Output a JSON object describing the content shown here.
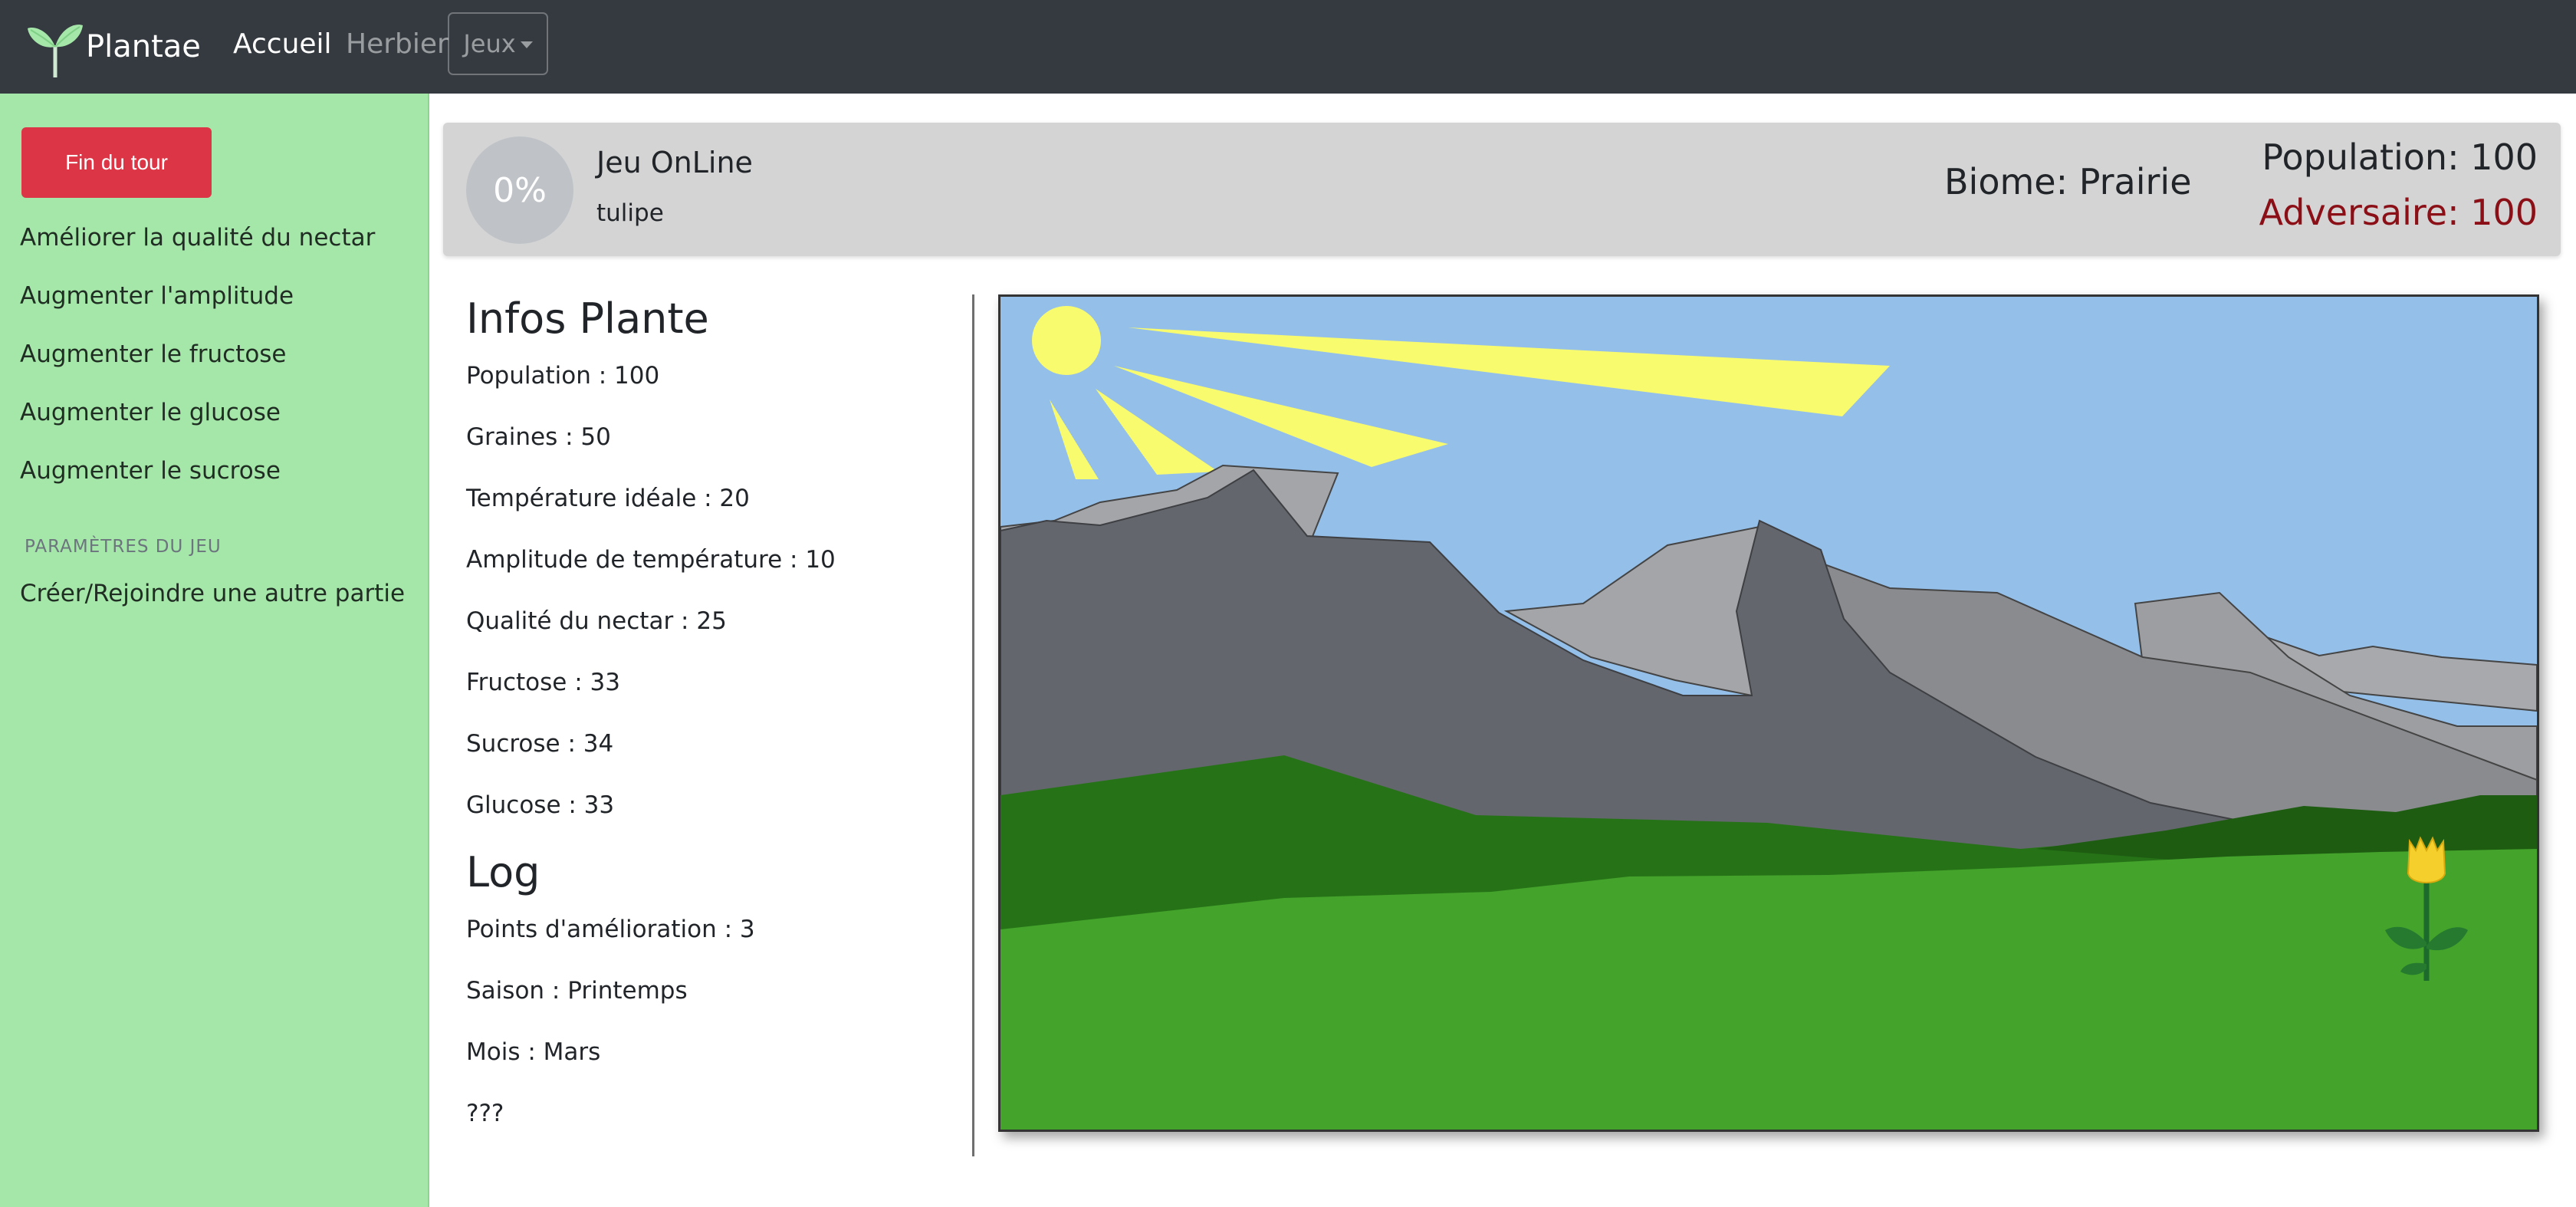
{
  "navbar": {
    "brand": "Plantae",
    "links": [
      {
        "label": "Accueil",
        "active": true
      },
      {
        "label": "Herbier",
        "active": false
      }
    ],
    "dropdown_label": "Jeux"
  },
  "sidebar": {
    "end_turn_label": "Fin du tour",
    "actions": [
      "Améliorer la qualité du nectar",
      "Augmenter l'amplitude",
      "Augmenter le fructose",
      "Augmenter le glucose",
      "Augmenter le sucrose"
    ],
    "settings_heading": "PARAMÈTRES DU JEU",
    "settings_items": [
      "Créer/Rejoindre une autre partie"
    ]
  },
  "header": {
    "progress": "0%",
    "game_title": "Jeu OnLine",
    "plant_name": "tulipe",
    "biome": "Biome: Prairie",
    "population": "Population: 100",
    "adversary": "Adversaire: 100"
  },
  "infos": {
    "title": "Infos Plante",
    "lines": [
      "Population : 100",
      "Graines : 50",
      "Température idéale : 20",
      "Amplitude de température : 10",
      "Qualité du nectar : 25",
      "Fructose : 33",
      "Sucrose : 34",
      "Glucose : 33"
    ]
  },
  "log": {
    "title": "Log",
    "lines": [
      "Points d'amélioration : 3",
      "Saison : Printemps",
      "Mois : Mars",
      "???"
    ]
  },
  "colors": {
    "navbar_bg": "#343a40",
    "sidebar_bg": "#a5e6a9",
    "danger": "#dc3545",
    "adversary_text": "#8b0f16",
    "sky": "#94bfe9",
    "sun": "#f9fb6e",
    "grass": "#43a32a"
  },
  "icons": {
    "brand": "seedling-icon",
    "dropdown": "caret-down-icon"
  }
}
